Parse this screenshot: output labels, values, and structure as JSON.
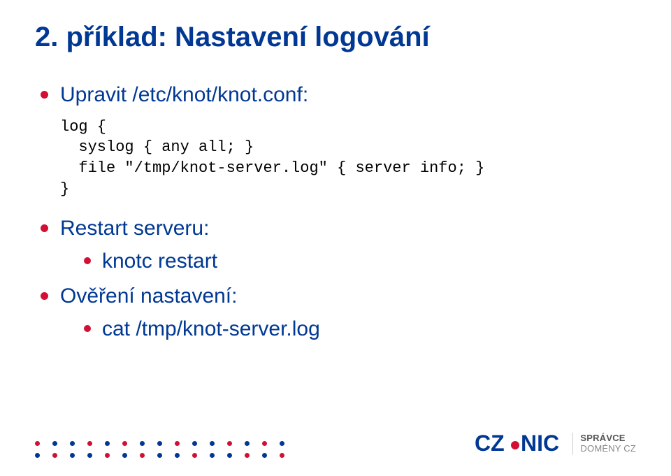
{
  "title": "2. příklad: Nastavení logování",
  "items": {
    "conf_label": "Upravit /etc/knot/knot.conf:",
    "code": "log {\n  syslog { any all; }\n  file \"/tmp/knot-server.log\" { server info; }\n}",
    "restart_label": "Restart serveru:",
    "restart_cmd": "knotc restart",
    "verify_label": "Ověření nastavení:",
    "verify_cmd": "cat /tmp/knot-server.log"
  },
  "logo": {
    "line1": "SPRÁVCE",
    "line2": "DOMÉNY CZ"
  }
}
